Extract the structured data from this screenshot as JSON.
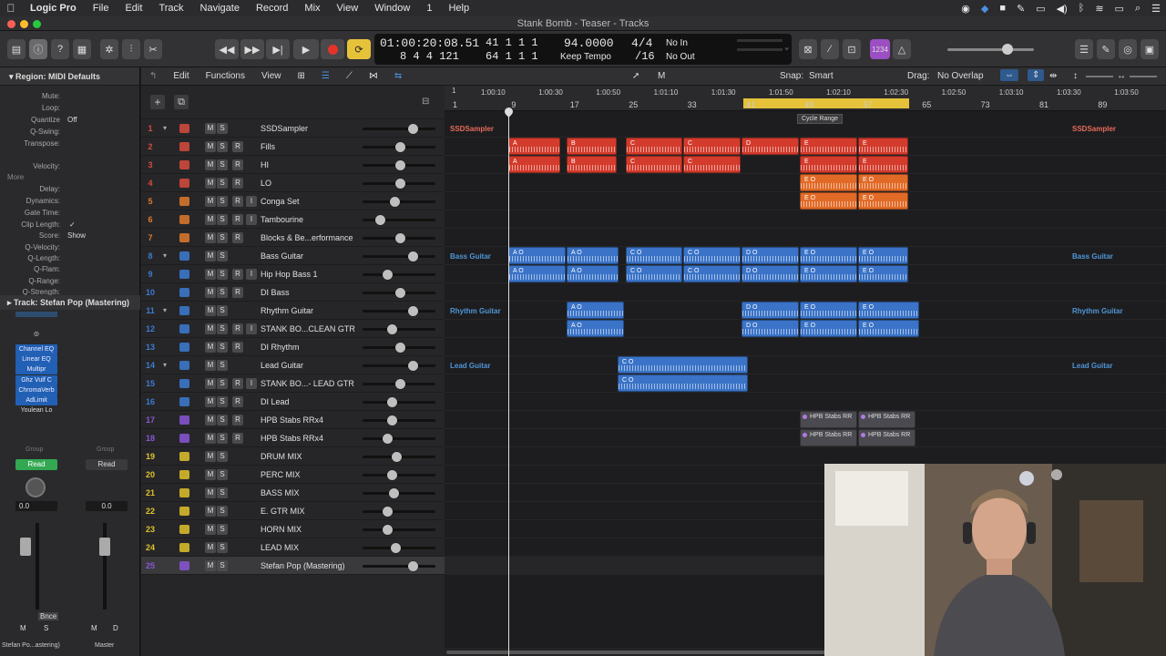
{
  "menubar": {
    "apple": "",
    "app": "Logic Pro",
    "items": [
      "File",
      "Edit",
      "Track",
      "Navigate",
      "Record",
      "Mix",
      "View",
      "Window",
      "1",
      "Help"
    ]
  },
  "window": {
    "title": "Stank Bomb - Teaser - Tracks"
  },
  "lcd": {
    "time": "01:00:20:08.51",
    "time_sub": "8  4  4  121",
    "bars": "41  1  1     1",
    "bars_sub": "64  1  1     1",
    "tempo": "94.0000",
    "tempo_mode": "Keep Tempo",
    "signature": "4/4",
    "division": "/16",
    "in": "No In",
    "out": "No Out"
  },
  "inspector": {
    "region_header": "Region: MIDI Defaults",
    "params": [
      {
        "k": "Mute:",
        "v": ""
      },
      {
        "k": "Loop:",
        "v": ""
      },
      {
        "k": "Quantize",
        "v": "Off"
      },
      {
        "k": "Q-Swing:",
        "v": ""
      },
      {
        "k": "Transpose:",
        "v": ""
      },
      {
        "k": "Velocity:",
        "v": ""
      },
      {
        "k": "More",
        "v": ""
      },
      {
        "k": "Delay:",
        "v": ""
      },
      {
        "k": "Dynamics:",
        "v": ""
      },
      {
        "k": "Gate Time:",
        "v": ""
      },
      {
        "k": "Clip Length:",
        "v": "✓"
      },
      {
        "k": "Score:",
        "v": "Show"
      },
      {
        "k": "Q-Velocity:",
        "v": ""
      },
      {
        "k": "Q-Length:",
        "v": ""
      },
      {
        "k": "Q-Flam:",
        "v": ""
      },
      {
        "k": "Q-Range:",
        "v": ""
      },
      {
        "k": "Q-Strength:",
        "v": ""
      }
    ],
    "track_header": "Track: Stefan Pop (Mastering)",
    "plugins": [
      "Channel EQ",
      "Linear EQ",
      "Multipr",
      "Ghz Vulf C",
      "ChromaVerb",
      "AdLimit",
      "Youlean Lo"
    ],
    "group_label": "Group",
    "read_label": "Read",
    "vol_left": "0.0",
    "vol_right": "0.0",
    "bnce": "Bnce",
    "strip_m": "M",
    "strip_s": "S",
    "strip_d": "D",
    "strip_name": "Stefan Po...astering)",
    "master_name": "Master"
  },
  "tracks_header": {
    "edit": "Edit",
    "functions": "Functions",
    "view": "View"
  },
  "arrange_header": {
    "snap_label": "Snap:",
    "snap_value": "Smart",
    "drag_label": "Drag:",
    "drag_value": "No Overlap",
    "cycle_tooltip": "Cycle Range"
  },
  "ruler": {
    "times": [
      "1:00:10",
      "1:00:30",
      "1:00:50",
      "1:01:10",
      "1:01:30",
      "1:01:50",
      "1:02:10",
      "1:02:30",
      "1:02:50",
      "1:03:10",
      "1:03:30",
      "1:03:50"
    ],
    "bars": [
      "1",
      "9",
      "17",
      "25",
      "33",
      "41",
      "49",
      "57",
      "65",
      "73",
      "81",
      "89"
    ],
    "top_left": "1"
  },
  "tracks": [
    {
      "n": "1",
      "name": "SSDSampler",
      "btns": [
        "M",
        "S"
      ],
      "folder": true,
      "color": "#d94b3c",
      "knob": 0.7
    },
    {
      "n": "2",
      "name": "Fills",
      "btns": [
        "M",
        "S",
        "R"
      ],
      "color": "#d94b3c",
      "knob": 0.5
    },
    {
      "n": "3",
      "name": "HI",
      "btns": [
        "M",
        "S",
        "R"
      ],
      "color": "#d94b3c",
      "knob": 0.5
    },
    {
      "n": "4",
      "name": "LO",
      "btns": [
        "M",
        "S",
        "R"
      ],
      "color": "#d94b3c",
      "knob": 0.5
    },
    {
      "n": "5",
      "name": "Conga Set",
      "btns": [
        "M",
        "S",
        "R",
        "I"
      ],
      "color": "#e07a2c",
      "knob": 0.42
    },
    {
      "n": "6",
      "name": "Tambourine",
      "btns": [
        "M",
        "S",
        "R",
        "I"
      ],
      "color": "#e07a2c",
      "knob": 0.2
    },
    {
      "n": "7",
      "name": "Blocks & Be...erformance",
      "btns": [
        "M",
        "S",
        "R"
      ],
      "color": "#e07a2c",
      "knob": 0.5
    },
    {
      "n": "8",
      "name": "Bass Guitar",
      "btns": [
        "M",
        "S"
      ],
      "folder": true,
      "color": "#3d7bd1",
      "knob": 0.7
    },
    {
      "n": "9",
      "name": "Hip Hop Bass 1",
      "btns": [
        "M",
        "S",
        "R",
        "I"
      ],
      "color": "#3d7bd1",
      "knob": 0.3
    },
    {
      "n": "10",
      "name": "DI Bass",
      "btns": [
        "M",
        "S",
        "R"
      ],
      "color": "#3d7bd1",
      "knob": 0.5
    },
    {
      "n": "11",
      "name": "Rhythm Guitar",
      "btns": [
        "M",
        "S"
      ],
      "folder": true,
      "color": "#3d7bd1",
      "knob": 0.7
    },
    {
      "n": "12",
      "name": "STANK BO...CLEAN GTR",
      "btns": [
        "M",
        "S",
        "R",
        "I"
      ],
      "color": "#3d7bd1",
      "knob": 0.38
    },
    {
      "n": "13",
      "name": "DI Rhythm",
      "btns": [
        "M",
        "S",
        "R"
      ],
      "color": "#3d7bd1",
      "knob": 0.5
    },
    {
      "n": "14",
      "name": "Lead Guitar",
      "btns": [
        "M",
        "S"
      ],
      "folder": true,
      "color": "#3d7bd1",
      "knob": 0.7
    },
    {
      "n": "15",
      "name": "STANK BO...- LEAD GTR",
      "btns": [
        "M",
        "S",
        "R",
        "I"
      ],
      "color": "#3d7bd1",
      "knob": 0.5
    },
    {
      "n": "16",
      "name": "DI Lead",
      "btns": [
        "M",
        "S",
        "R"
      ],
      "color": "#3d7bd1",
      "knob": 0.38
    },
    {
      "n": "17",
      "name": "HPB Stabs RRx4",
      "btns": [
        "M",
        "S",
        "R"
      ],
      "color": "#8a56d6",
      "knob": 0.38
    },
    {
      "n": "18",
      "name": "HPB Stabs RRx4",
      "btns": [
        "M",
        "S",
        "R"
      ],
      "color": "#8a56d6",
      "knob": 0.3
    },
    {
      "n": "19",
      "name": "DRUM MIX",
      "btns": [
        "M",
        "S"
      ],
      "color": "#e0c22c",
      "knob": 0.45
    },
    {
      "n": "20",
      "name": "PERC MIX",
      "btns": [
        "M",
        "S"
      ],
      "color": "#e0c22c",
      "knob": 0.37
    },
    {
      "n": "21",
      "name": "BASS MIX",
      "btns": [
        "M",
        "S"
      ],
      "color": "#e0c22c",
      "knob": 0.4
    },
    {
      "n": "22",
      "name": "E. GTR MIX",
      "btns": [
        "M",
        "S"
      ],
      "color": "#e0c22c",
      "knob": 0.3
    },
    {
      "n": "23",
      "name": "HORN MIX",
      "btns": [
        "M",
        "S"
      ],
      "color": "#e0c22c",
      "knob": 0.3
    },
    {
      "n": "24",
      "name": "LEAD MIX",
      "btns": [
        "M",
        "S"
      ],
      "color": "#e0c22c",
      "knob": 0.43
    },
    {
      "n": "25",
      "name": "Stefan Pop (Mastering)",
      "btns": [
        "M",
        "S"
      ],
      "color": "#8a56d6",
      "knob": 0.7,
      "selected": true
    }
  ],
  "folder_labels": {
    "ssd": "SSDSampler",
    "bass": "Bass Guitar",
    "rhythm": "Rhythm Guitar",
    "lead": "Lead Guitar"
  },
  "region_labels": {
    "A": "A",
    "B": "B",
    "C": "C",
    "D": "D",
    "E": "E",
    "AO": "A O",
    "CO": "C O",
    "DO": "D O",
    "EO": "E O",
    "hpb": "HPB Stabs RR"
  },
  "colors": {
    "red": "#d33b2c",
    "orange": "#e26a27",
    "blue": "#3a73c7",
    "gray": "#4a4a50",
    "accent": "#e6c23a"
  }
}
